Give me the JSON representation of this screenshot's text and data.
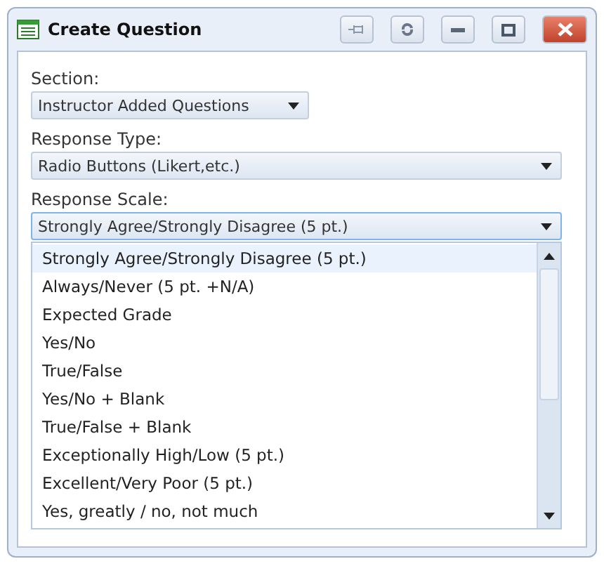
{
  "window": {
    "title": "Create Question"
  },
  "fields": [
    {
      "label": "Section:",
      "value": "Instructor Added Questions",
      "wide": false,
      "focused": false
    },
    {
      "label": "Response Type:",
      "value": "Radio Buttons (Likert,etc.)",
      "wide": true,
      "focused": false
    },
    {
      "label": "Response Scale:",
      "value": "Strongly Agree/Strongly Disagree (5 pt.)",
      "wide": true,
      "focused": true
    }
  ],
  "options": [
    {
      "label": "Strongly Agree/Strongly Disagree (5 pt.)",
      "selected": true
    },
    {
      "label": "Always/Never (5 pt. +N/A)",
      "selected": false
    },
    {
      "label": "Expected Grade",
      "selected": false
    },
    {
      "label": "Yes/No",
      "selected": false
    },
    {
      "label": "True/False",
      "selected": false
    },
    {
      "label": "Yes/No + Blank",
      "selected": false
    },
    {
      "label": "True/False + Blank",
      "selected": false
    },
    {
      "label": "Exceptionally High/Low (5 pt.)",
      "selected": false
    },
    {
      "label": "Excellent/Very Poor (5 pt.)",
      "selected": false
    },
    {
      "label": "Yes, greatly / no, not much",
      "selected": false
    }
  ]
}
